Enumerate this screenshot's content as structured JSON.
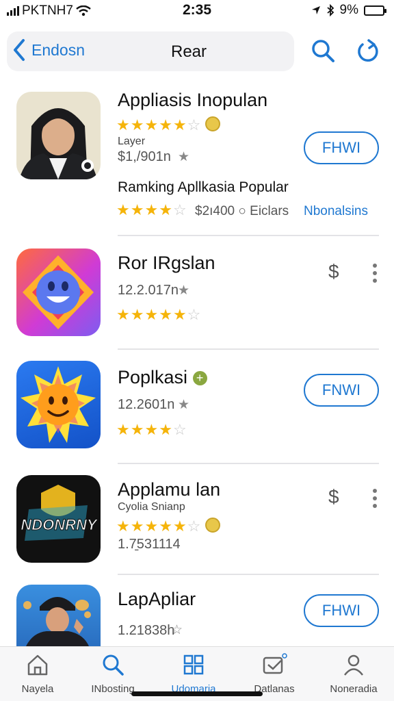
{
  "status_bar": {
    "carrier": "PKTNH7",
    "time": "2:35",
    "battery": "9%"
  },
  "nav": {
    "back_label": "Endosn",
    "title": "Rear"
  },
  "apps": [
    {
      "name": "Appliasis Inopulan",
      "subtitle": "Layer",
      "meta": "$1,/901n",
      "rating": 4.5,
      "action": "FHWI"
    },
    {
      "name": "Ror IRgslan",
      "meta": "12.2.017n",
      "rating": 4.5
    },
    {
      "name": "Poplkasi",
      "meta": "12.2601n",
      "rating": 3.5,
      "action": "FNWI"
    },
    {
      "name": "Applamu lan",
      "subtitle": "Cyolia Snianp",
      "meta": "1.7̱531114",
      "rating": 4.5
    },
    {
      "name": "LapApliar",
      "meta": "1.21838h",
      "action": "FHWI"
    }
  ],
  "ranking": {
    "title": "Ramking Apllkasia Popular",
    "meta": "$2ı400 ○ Eiclars",
    "link": "Nbonalsins",
    "rating": 3.5
  },
  "icon4_text": "NDONRNY",
  "tabs": [
    {
      "label": "Nayela",
      "icon": "home-icon"
    },
    {
      "label": "INbosting",
      "icon": "search-icon"
    },
    {
      "label": "Udomaria",
      "icon": "grid-icon",
      "active": true
    },
    {
      "label": "Datlanas",
      "icon": "screen-icon"
    },
    {
      "label": "Noneradia",
      "icon": "person-icon"
    }
  ],
  "colors": {
    "accent": "#1f78d1",
    "star": "#f5b40a"
  }
}
